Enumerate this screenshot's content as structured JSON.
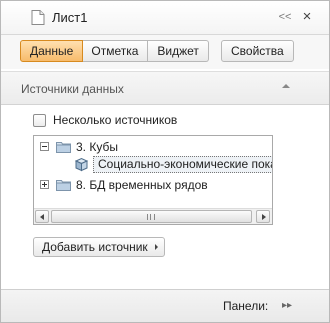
{
  "header": {
    "title": "Лист1",
    "collapse_symbol": "<<",
    "close_symbol": "×"
  },
  "tabs": {
    "items": [
      {
        "label": "Данные",
        "active": true
      },
      {
        "label": "Отметка",
        "active": false
      },
      {
        "label": "Виджет",
        "active": false
      }
    ],
    "properties_label": "Свойства"
  },
  "data_sources": {
    "section_title": "Источники данных",
    "multiple_sources_label": "Несколько источников",
    "multiple_sources_checked": false,
    "tree": {
      "nodes": [
        {
          "label": "3. Кубы",
          "expanded": true,
          "level": 0,
          "icon": "folder-icon"
        },
        {
          "label": "Социально-экономические показатели",
          "level": 1,
          "icon": "cube-icon",
          "selected": true
        },
        {
          "label": "8. БД временных рядов",
          "expanded": false,
          "level": 0,
          "icon": "folder-icon"
        }
      ]
    },
    "add_source_label": "Добавить источник"
  },
  "footer": {
    "panels_label": "Панели:",
    "expand_symbol": "▸▸"
  },
  "colors": {
    "active_tab_top": "#ffe0b0",
    "active_tab_bottom": "#f7bb6b",
    "active_tab_border": "#d78a1f",
    "folder": "#bcd0e4"
  }
}
